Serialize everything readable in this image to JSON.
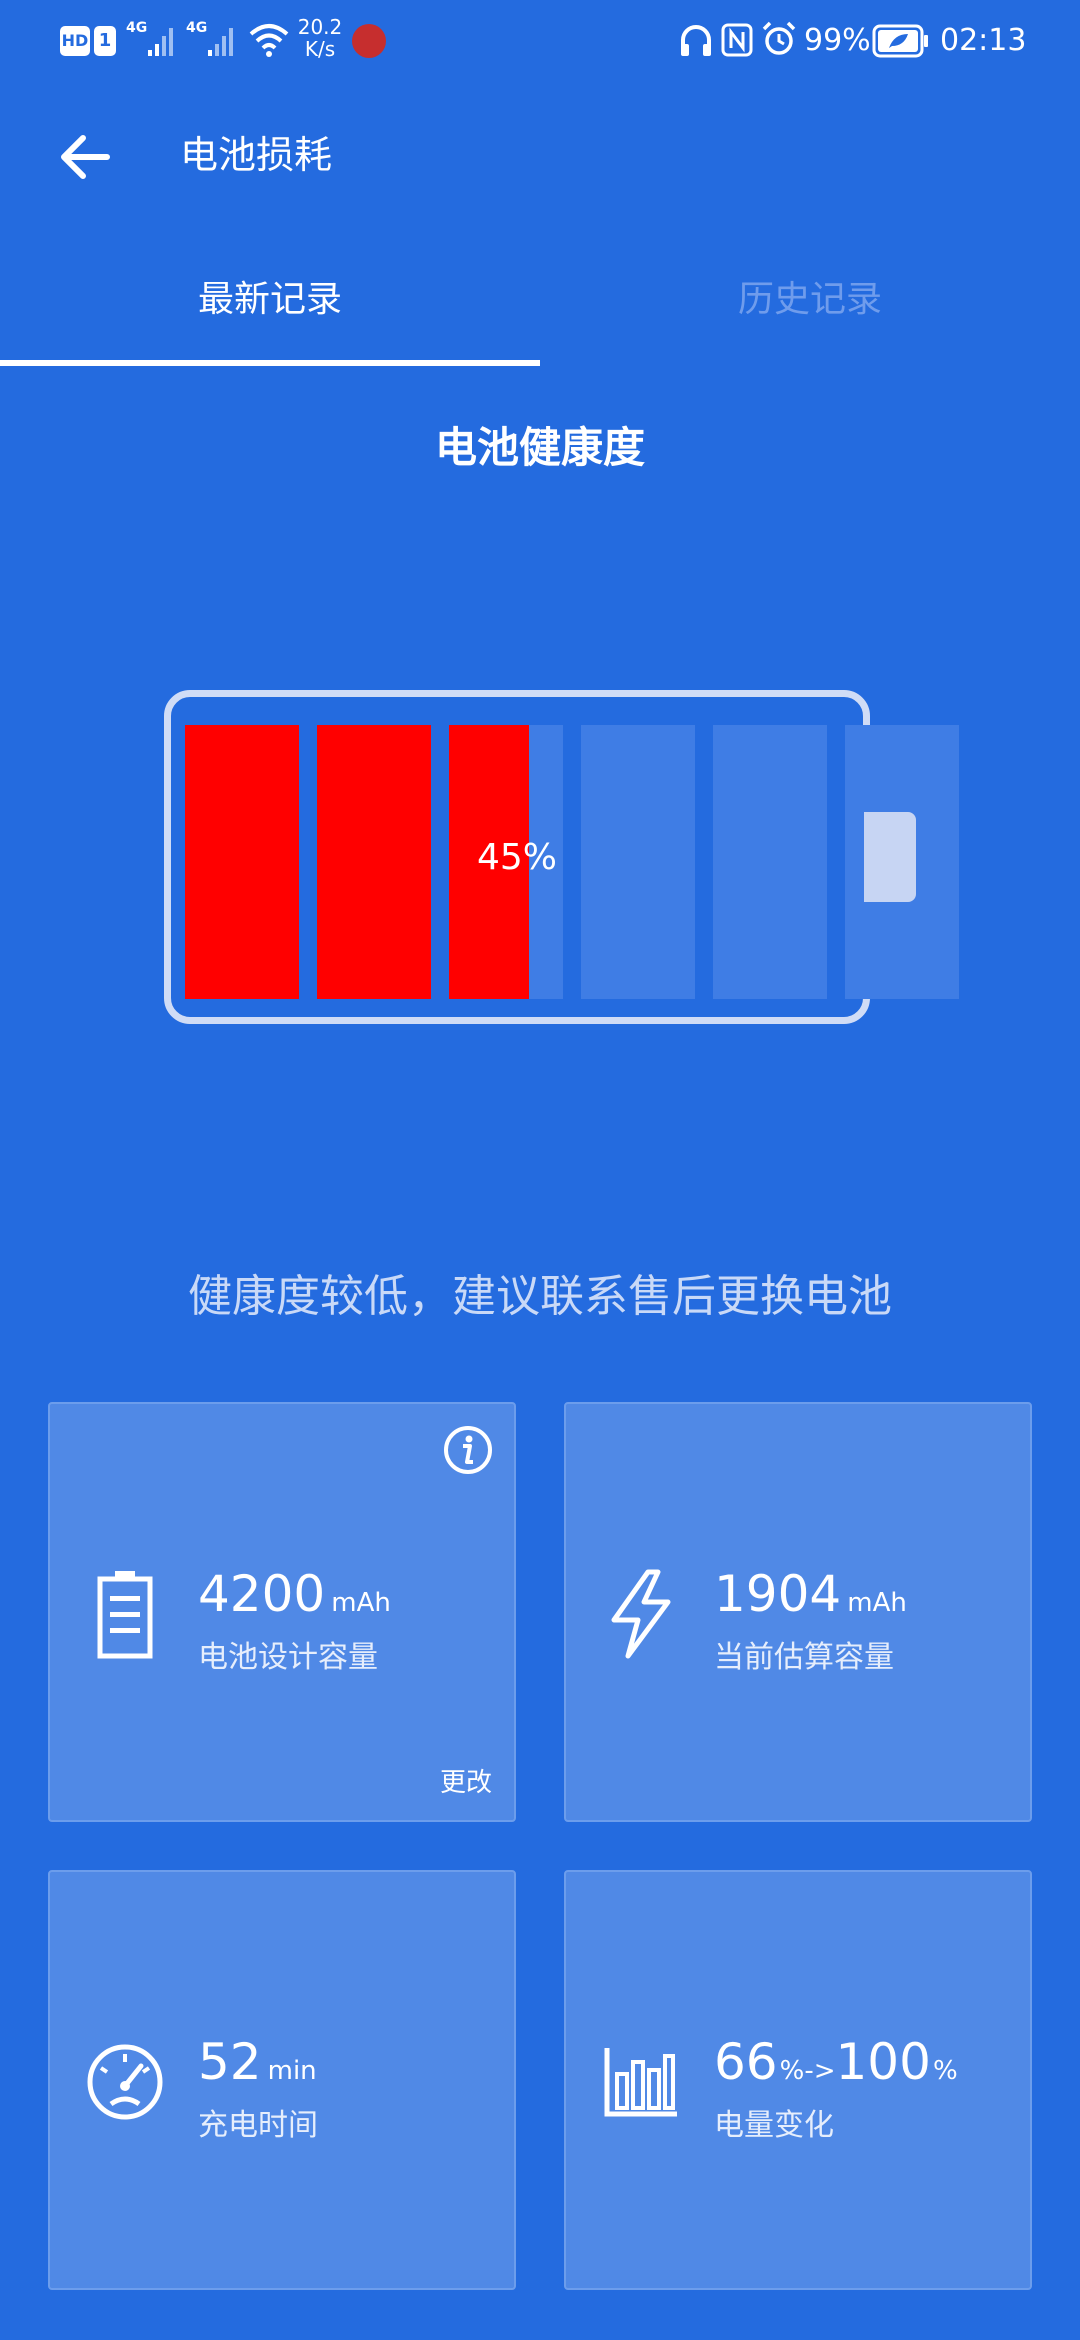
{
  "status_bar": {
    "hd": "HD",
    "sim1": "1",
    "net1": "4G",
    "net2": "4G",
    "speed_value": "20.2",
    "speed_unit": "K/s",
    "battery_pct": "99%",
    "time": "02:13"
  },
  "header": {
    "title": "电池损耗"
  },
  "tabs": [
    {
      "label": "最新记录",
      "active": true
    },
    {
      "label": "历史记录",
      "active": false
    }
  ],
  "section_title": "电池健康度",
  "battery": {
    "health_percent": 45,
    "health_label": "45%",
    "segments": 6
  },
  "advice": "健康度较低，建议联系售后更换电池",
  "cards": {
    "design": {
      "value": "4200",
      "unit": "mAh",
      "label": "电池设计容量",
      "link": "更改"
    },
    "estimated": {
      "value": "1904",
      "unit": "mAh",
      "label": "当前估算容量"
    },
    "charge_time": {
      "value": "52",
      "unit": "min",
      "label": "充电时间"
    },
    "level_change": {
      "from": "66",
      "from_unit": "%->",
      "to": "100",
      "to_unit": "%",
      "label": "电量变化"
    }
  },
  "colors": {
    "background": "#246bdf",
    "battery_fill": "#ff0000",
    "card": "#5089e6"
  },
  "icons": [
    "arrow-left-icon",
    "info-icon",
    "battery-outline-icon",
    "lightning-icon",
    "speedometer-icon",
    "bar-chart-icon",
    "headphones-icon",
    "nfc-icon",
    "alarm-icon",
    "wifi-icon"
  ]
}
